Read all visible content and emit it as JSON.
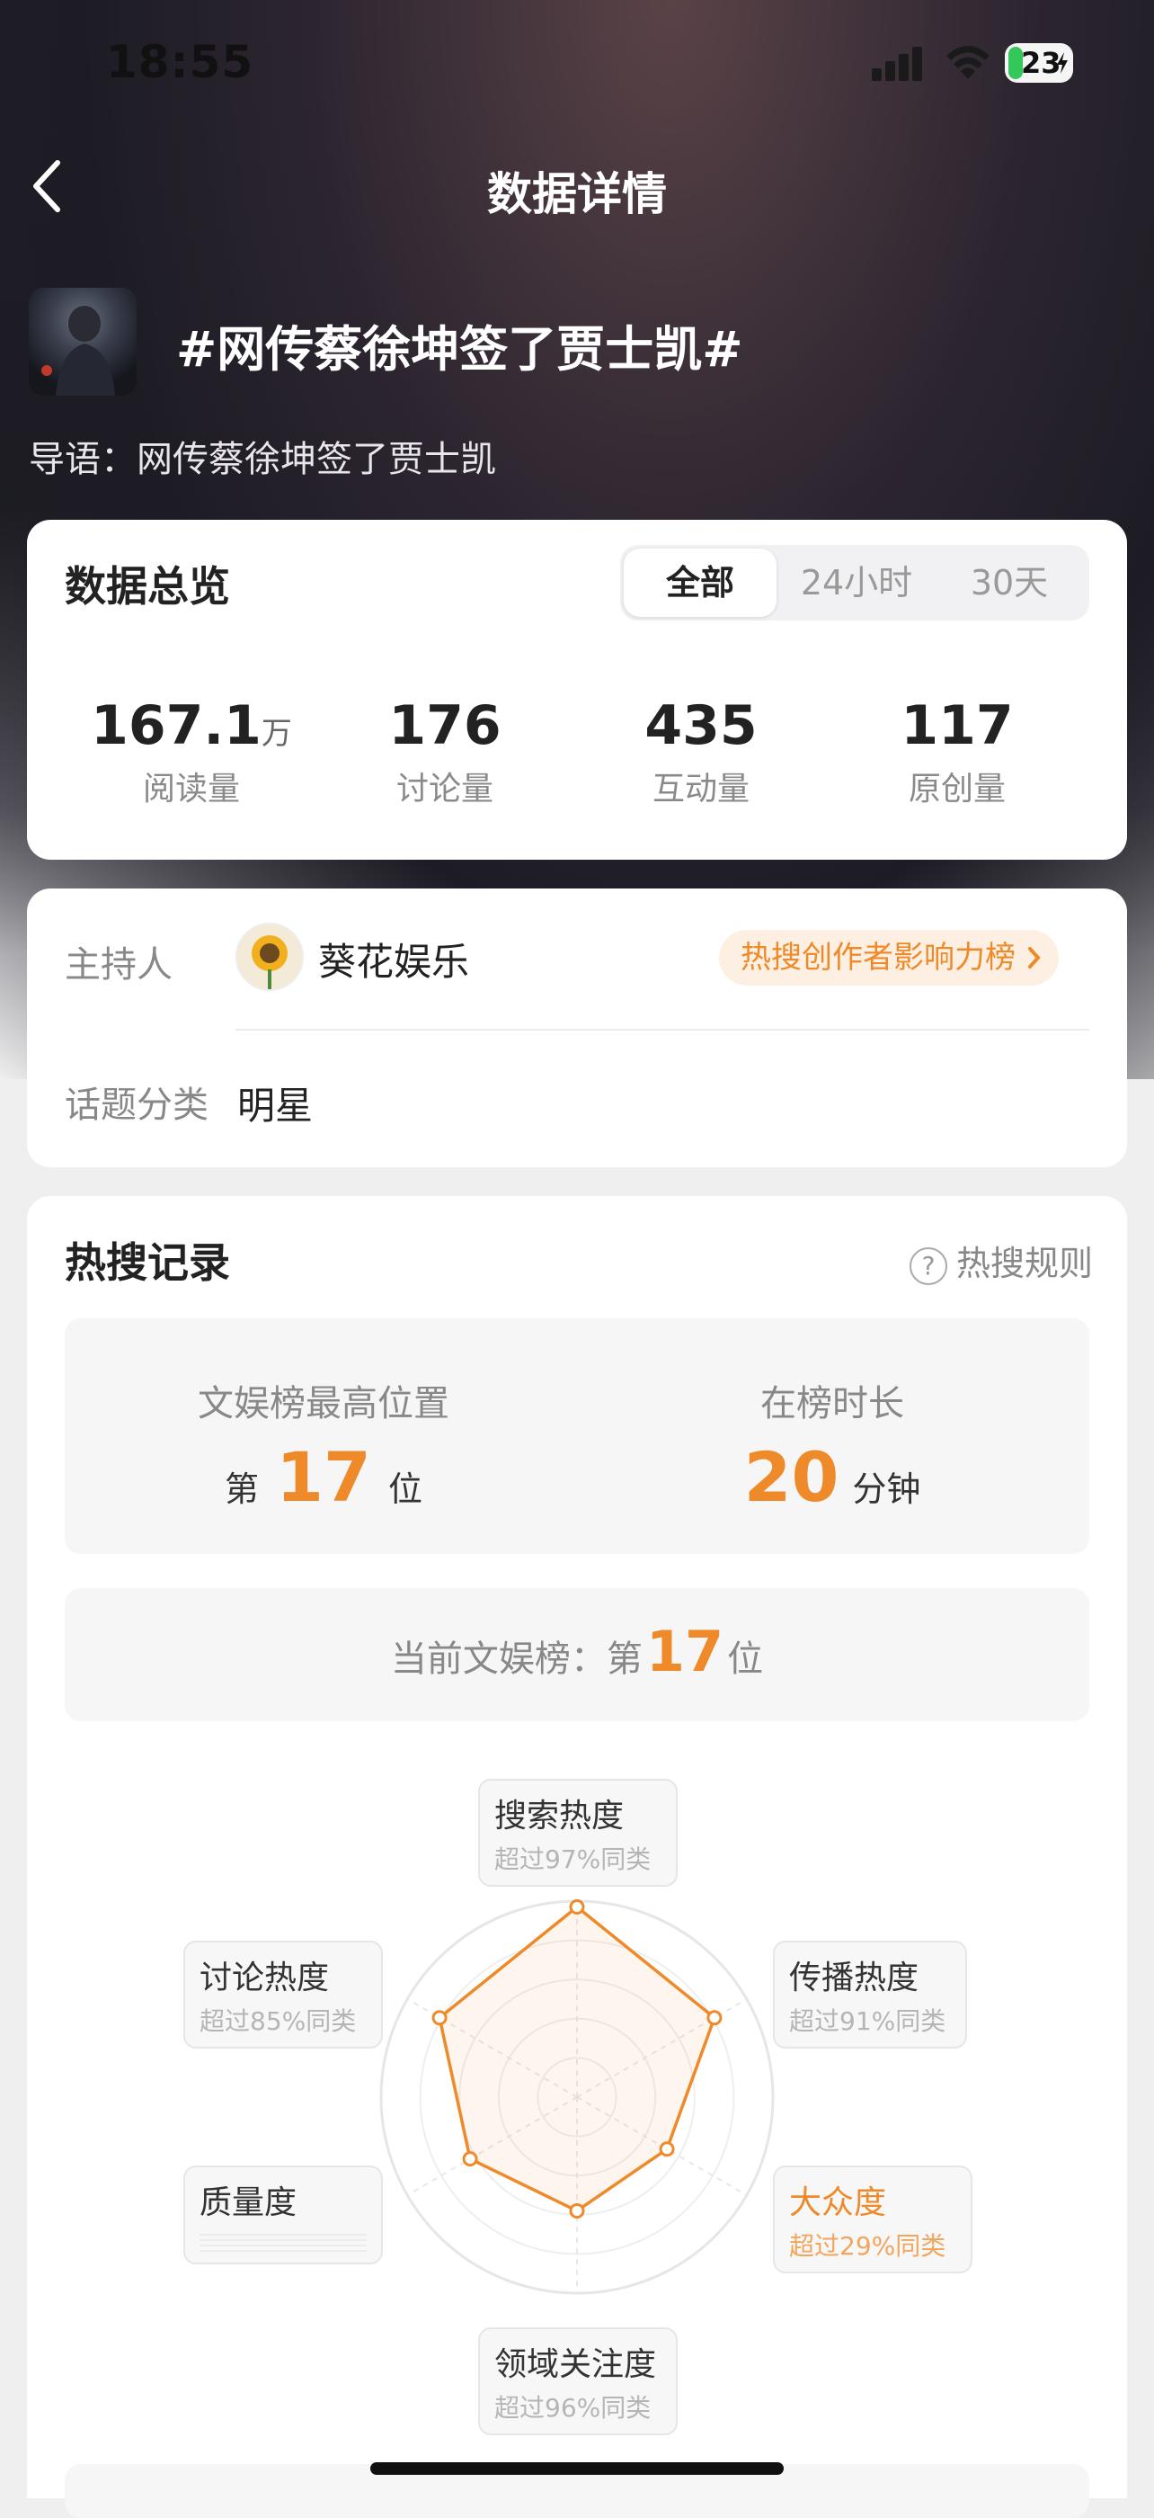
{
  "status_bar": {
    "time": "18:55",
    "battery": "23"
  },
  "nav": {
    "title": "数据详情"
  },
  "topic": {
    "title": "#网传蔡徐坤签了贾士凯#",
    "lead_label": "导语：",
    "lead_text": "网传蔡徐坤签了贾士凯"
  },
  "overview": {
    "title": "数据总览",
    "tabs": [
      {
        "label": "全部",
        "active": true
      },
      {
        "label": "24小时",
        "active": false
      },
      {
        "label": "30天",
        "active": false
      }
    ],
    "stats": [
      {
        "value": "167.1",
        "unit": "万",
        "label": "阅读量"
      },
      {
        "value": "176",
        "unit": "",
        "label": "讨论量"
      },
      {
        "value": "435",
        "unit": "",
        "label": "互动量"
      },
      {
        "value": "117",
        "unit": "",
        "label": "原创量"
      }
    ]
  },
  "info": {
    "host_label": "主持人",
    "host_name": "葵花娱乐",
    "rank_link": "热搜创作者影响力榜",
    "category_label": "话题分类",
    "category_value": "明星"
  },
  "hot_record": {
    "title": "热搜记录",
    "rule_label": "热搜规则",
    "peak_label": "文娱榜最高位置",
    "peak_prefix": "第",
    "peak_value": "17",
    "peak_suffix": "位",
    "duration_label": "在榜时长",
    "duration_value": "20",
    "duration_unit": "分钟",
    "current_prefix": "当前文娱榜：第",
    "current_value": "17",
    "current_suffix": "位"
  },
  "radar": {
    "accent": "#ef8a2a",
    "axes": [
      {
        "name": "搜索热度",
        "note": "超过97%同类",
        "value": 0.97,
        "highlight": false
      },
      {
        "name": "传播热度",
        "note": "超过91%同类",
        "value": 0.81,
        "highlight": false
      },
      {
        "name": "大众度",
        "note": "超过29%同类",
        "value": 0.53,
        "highlight": true
      },
      {
        "name": "领域关注度",
        "note": "超过96%同类",
        "value": 0.58,
        "highlight": false
      },
      {
        "name": "质量度",
        "note": "",
        "value": 0.63,
        "highlight": false
      },
      {
        "name": "讨论热度",
        "note": "超过85%同类",
        "value": 0.81,
        "highlight": false
      }
    ]
  }
}
